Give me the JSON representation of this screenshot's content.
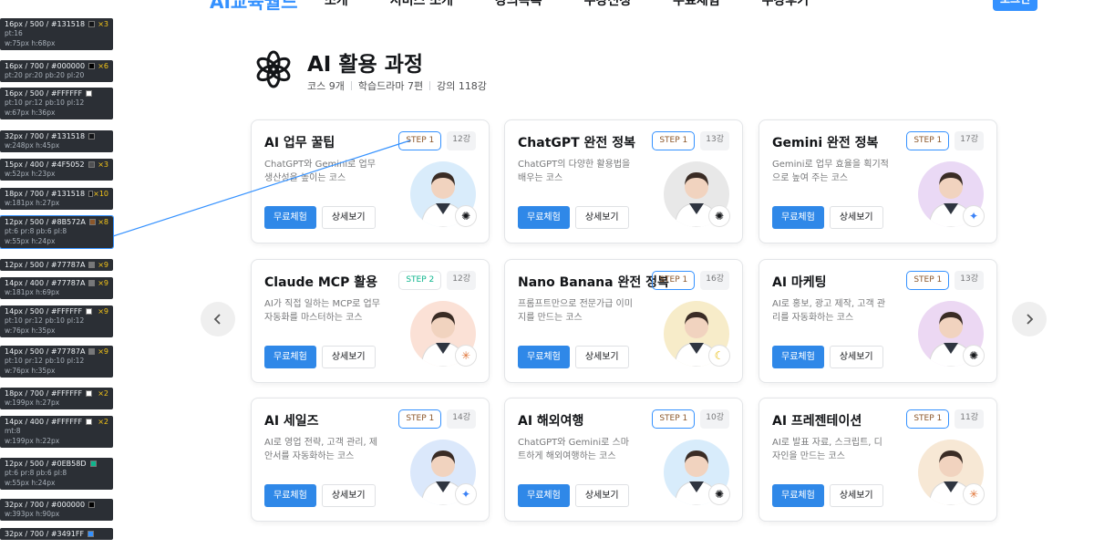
{
  "nav": {
    "logo": "AI교육월드",
    "links": [
      "소개",
      "서비스 소개",
      "강의목록",
      "수강신청",
      "무료체험",
      "수강후기"
    ],
    "login": "로그인"
  },
  "header": {
    "title": "AI 활용 과정",
    "stats": [
      "코스 9개",
      "학습드라마 7편",
      "강의 118강"
    ]
  },
  "cards": [
    {
      "title": "AI 업무 꿀팁",
      "step": "STEP 1",
      "lectures": "12강",
      "desc": "ChatGPT와 Gemini로 업무 생산성을 높이는 코스",
      "primary": "무료체험",
      "secondary": "상세보기",
      "chip": "chatgpt-icon",
      "avatar_bg": "#d9ecfb"
    },
    {
      "title": "ChatGPT 완전 정복",
      "step": "STEP 1",
      "lectures": "13강",
      "desc": "ChatGPT의 다양한 활용법을 배우는 코스",
      "primary": "무료체험",
      "secondary": "상세보기",
      "chip": "chatgpt-icon",
      "avatar_bg": "#e8e8e8"
    },
    {
      "title": "Gemini 완전 정복",
      "step": "STEP 1",
      "lectures": "17강",
      "desc": "Gemini로 업무 효율을 획기적으로 높여 주는 코스",
      "primary": "무료체험",
      "secondary": "상세보기",
      "chip": "gemini-icon",
      "avatar_bg": "#ead9f5"
    },
    {
      "title": "Claude MCP 활용",
      "step": "STEP 2",
      "lectures": "12강",
      "desc": "AI가 직접 일하는 MCP로 업무 자동화를 마스터하는 코스",
      "primary": "무료체험",
      "secondary": "상세보기",
      "chip": "claude-icon",
      "avatar_bg": "#fbe1d6"
    },
    {
      "title": "Nano Banana 완전 정복",
      "step": "STEP 1",
      "lectures": "16강",
      "desc": "프롬프트만으로 전문가급 이미지를 만드는 코스",
      "primary": "무료체험",
      "secondary": "상세보기",
      "chip": "banana-icon",
      "avatar_bg": "#f7ecc9"
    },
    {
      "title": "AI 마케팅",
      "step": "STEP 1",
      "lectures": "13강",
      "desc": "AI로 홍보, 광고 제작, 고객 관리를 자동화하는 코스",
      "primary": "무료체험",
      "secondary": "상세보기",
      "chip": "chatgpt-icon",
      "avatar_bg": "#ecd8f3"
    },
    {
      "title": "AI 세일즈",
      "step": "STEP 1",
      "lectures": "14강",
      "desc": "AI로 영업 전략, 고객 관리, 제안서를 자동화하는 코스",
      "primary": "무료체험",
      "secondary": "상세보기",
      "chip": "gemini-icon",
      "avatar_bg": "#dbe8fb"
    },
    {
      "title": "AI 해외여행",
      "step": "STEP 1",
      "lectures": "10강",
      "desc": "ChatGPT와 Gemini로 스마트하게 해외여행하는 코스",
      "primary": "무료체험",
      "secondary": "상세보기",
      "chip": "chatgpt-icon",
      "avatar_bg": "#d8ecfb"
    },
    {
      "title": "AI 프레젠테이션",
      "step": "STEP 1",
      "lectures": "11강",
      "desc": "AI로 발표 자료, 스크립트, 디자인을 만드는 코스",
      "primary": "무료체험",
      "secondary": "상세보기",
      "chip": "claude-icon",
      "avatar_bg": "#f7e8d5"
    }
  ],
  "inspector": [
    {
      "l": "16px / 500 / #131518",
      "c": "×3",
      "sw": "#131518",
      "s": [
        "pt:16",
        "w:75px h:68px"
      ]
    },
    {
      "l": "16px / 700 / #000000",
      "c": "×6",
      "sw": "#000000",
      "s": [
        "pt:20 pr:20 pb:20 pl:20"
      ]
    },
    {
      "l": "16px / 500 / #FFFFFF",
      "c": "",
      "sw": "#FFFFFF",
      "s": [
        "pt:10 pr:12 pb:10 pl:12",
        "w:67px h:36px"
      ]
    },
    {
      "l": "32px / 700 / #131518",
      "c": "",
      "sw": "#131518",
      "s": [
        "w:248px h:45px"
      ]
    },
    {
      "l": "15px / 400 / #4F5052",
      "c": "×3",
      "sw": "#4F5052",
      "s": [
        "w:52px h:23px"
      ]
    },
    {
      "l": "18px / 700 / #131518",
      "c": "×10",
      "sw": "#131518",
      "s": [
        "w:181px h:27px"
      ]
    },
    {
      "l": "12px / 500 / #8B572A",
      "c": "×8",
      "sw": "#8B572A",
      "s": [
        "pt:6 pr:8 pb:6 pl:8",
        "w:55px h:24px"
      ],
      "active": true
    },
    {
      "l": "12px / 500 / #77787A",
      "c": "×9",
      "sw": "#77787A",
      "s": []
    },
    {
      "l": "14px / 400 / #77787A",
      "c": "×9",
      "sw": "#77787A",
      "s": [
        "w:181px h:69px"
      ]
    },
    {
      "l": "14px / 500 / #FFFFFF",
      "c": "×9",
      "sw": "#FFFFFF",
      "s": [
        "pt:10 pr:12 pb:10 pl:12",
        "w:76px h:35px"
      ]
    },
    {
      "l": "14px / 500 / #77787A",
      "c": "×9",
      "sw": "#77787A",
      "s": [
        "pt:10 pr:12 pb:10 pl:12",
        "w:76px h:35px"
      ]
    },
    {
      "l": "18px / 700 / #FFFFFF",
      "c": "×2",
      "sw": "#FFFFFF",
      "s": [
        "w:199px h:27px"
      ]
    },
    {
      "l": "14px / 400 / #FFFFFF",
      "c": "×2",
      "sw": "#FFFFFF",
      "s": [
        "mt:8",
        "w:199px h:22px"
      ]
    },
    {
      "l": "12px / 500 / #0EB58D",
      "c": "",
      "sw": "#0EB58D",
      "s": [
        "pt:6 pr:8 pb:6 pl:8",
        "w:55px h:24px"
      ]
    },
    {
      "l": "32px / 700 / #000000",
      "c": "",
      "sw": "#000000",
      "s": [
        "w:393px h:90px"
      ]
    },
    {
      "l": "32px / 700 / #3491FF",
      "c": "",
      "sw": "#3491FF",
      "s": []
    }
  ]
}
